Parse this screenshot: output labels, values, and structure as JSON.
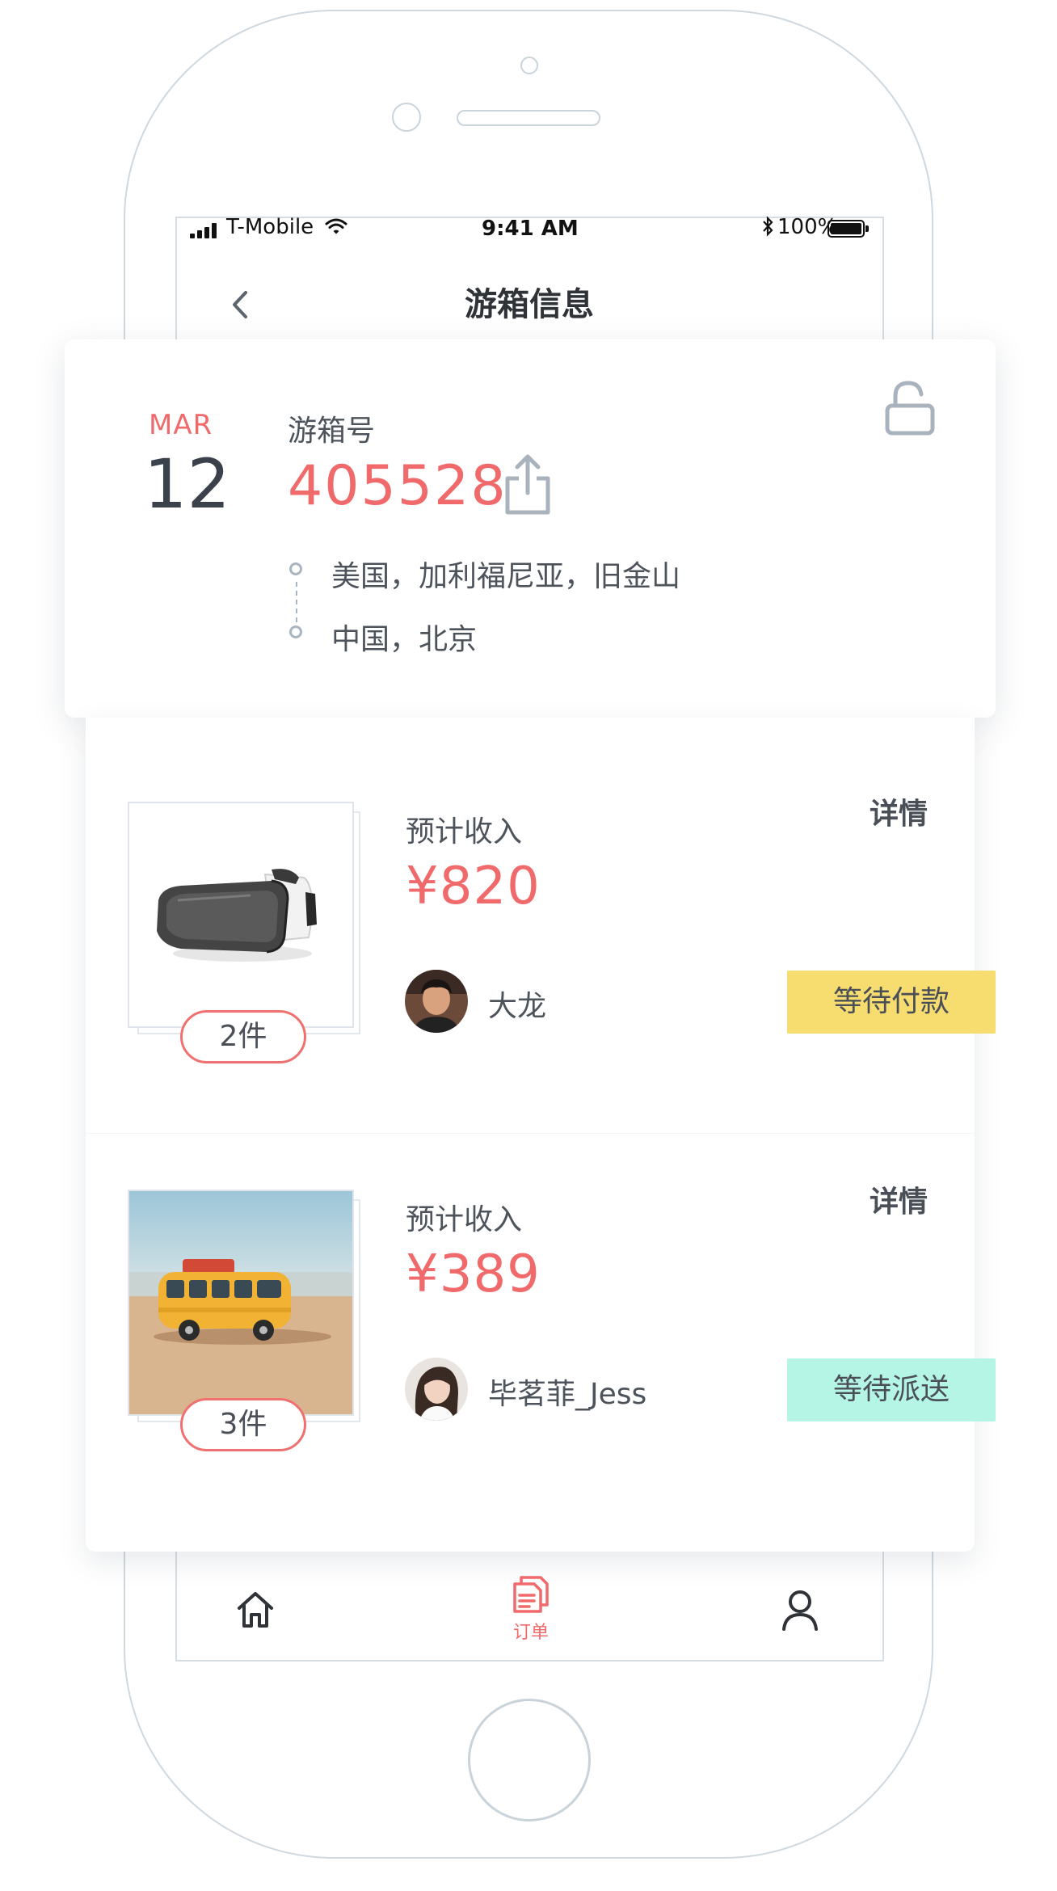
{
  "status_bar": {
    "carrier": "T-Mobile",
    "time": "9:41 AM",
    "battery": "100%"
  },
  "nav": {
    "back_icon": "chevron-left-icon",
    "title": "游箱信息"
  },
  "box": {
    "month": "MAR",
    "day": "12",
    "label": "游箱号",
    "number": "405528",
    "origin": "美国，加利福尼亚，旧金山",
    "destination": "中国，北京"
  },
  "orders": [
    {
      "income_label": "预计收入",
      "price": "¥820",
      "details": "详情",
      "quantity": "2件",
      "user": "大龙",
      "status": "等待付款",
      "status_color": "#f7dc6f",
      "product": "vr-headset"
    },
    {
      "income_label": "预计收入",
      "price": "¥389",
      "details": "详情",
      "quantity": "3件",
      "user": "毕茗菲_Jess",
      "status": "等待派送",
      "status_color": "#b5f5e6",
      "product": "toy-bus"
    }
  ],
  "tabbar": {
    "items": [
      {
        "icon": "home-icon",
        "label": ""
      },
      {
        "icon": "orders-icon",
        "label": "订单",
        "active": true
      },
      {
        "icon": "user-icon",
        "label": ""
      }
    ]
  },
  "colors": {
    "accent": "#f0696b",
    "text": "#4a4f57",
    "muted": "#a9b6c1"
  }
}
